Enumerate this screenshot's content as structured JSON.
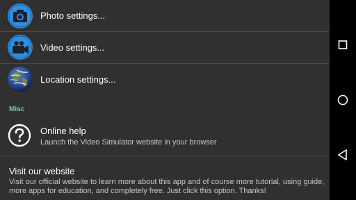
{
  "settings": {
    "items": [
      {
        "title": "Photo settings...",
        "icon": "camera-icon"
      },
      {
        "title": "Video settings...",
        "icon": "video-camera-icon"
      },
      {
        "title": "Location settings...",
        "icon": "earth-globe-icon"
      }
    ],
    "misc_category": "Misc",
    "online_help": {
      "title": "Online help",
      "summary": "Launch the Video Simulator website in your browser",
      "icon": "help-question-icon"
    },
    "visit_website": {
      "title": "Visit our website",
      "summary": "Visit our official website to learn more about this app and of course more tutorial, using guide, more apps for education, and completely free. Just click this option. Thanks!"
    }
  },
  "navbar": {
    "buttons": [
      "recent-apps-icon",
      "home-icon",
      "back-icon"
    ]
  },
  "colors": {
    "background": "#303030",
    "accent_blue": "#2f8fe0",
    "category_teal": "#7fc6b3",
    "divider": "#4a4a4a"
  }
}
